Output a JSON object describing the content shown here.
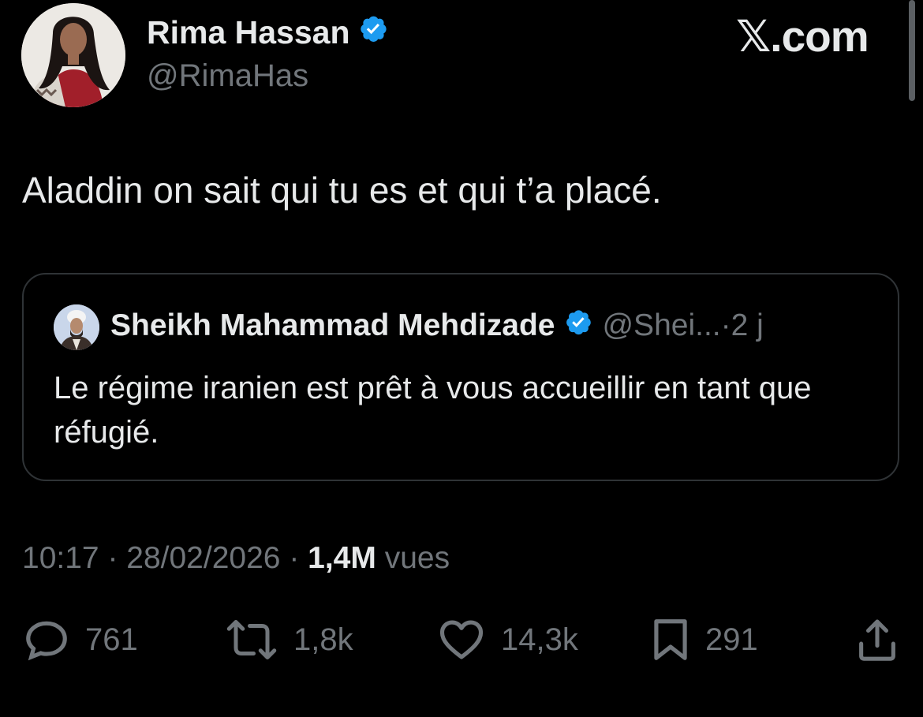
{
  "author": {
    "display_name": "Rima Hassan",
    "handle": "@RimaHas",
    "verified_icon": "verified-badge-icon"
  },
  "brand": {
    "logo_text": "𝕏.com"
  },
  "tweet": {
    "text": "Aladdin on sait qui tu es et qui t’a placé."
  },
  "quote": {
    "display_name": "Sheikh Mahammad Mehdizade",
    "handle": "@Shei...",
    "separator": " · ",
    "age": "2 j",
    "text": "Le régime iranien est prêt à vous accueillir en tant que réfugié."
  },
  "meta": {
    "time": "10:17",
    "date": "28/02/2026",
    "views_count": "1,4M",
    "views_label": "vues",
    "sep1": " · ",
    "sep2": " · "
  },
  "actions": {
    "replies": "761",
    "reposts": "1,8k",
    "likes": "14,3k",
    "bookmarks": "291"
  },
  "colors": {
    "background": "#000000",
    "primary_text": "#e7e9ea",
    "secondary_text": "#71767b",
    "border": "#2f3336",
    "verified_blue": "#1d9bf0"
  }
}
